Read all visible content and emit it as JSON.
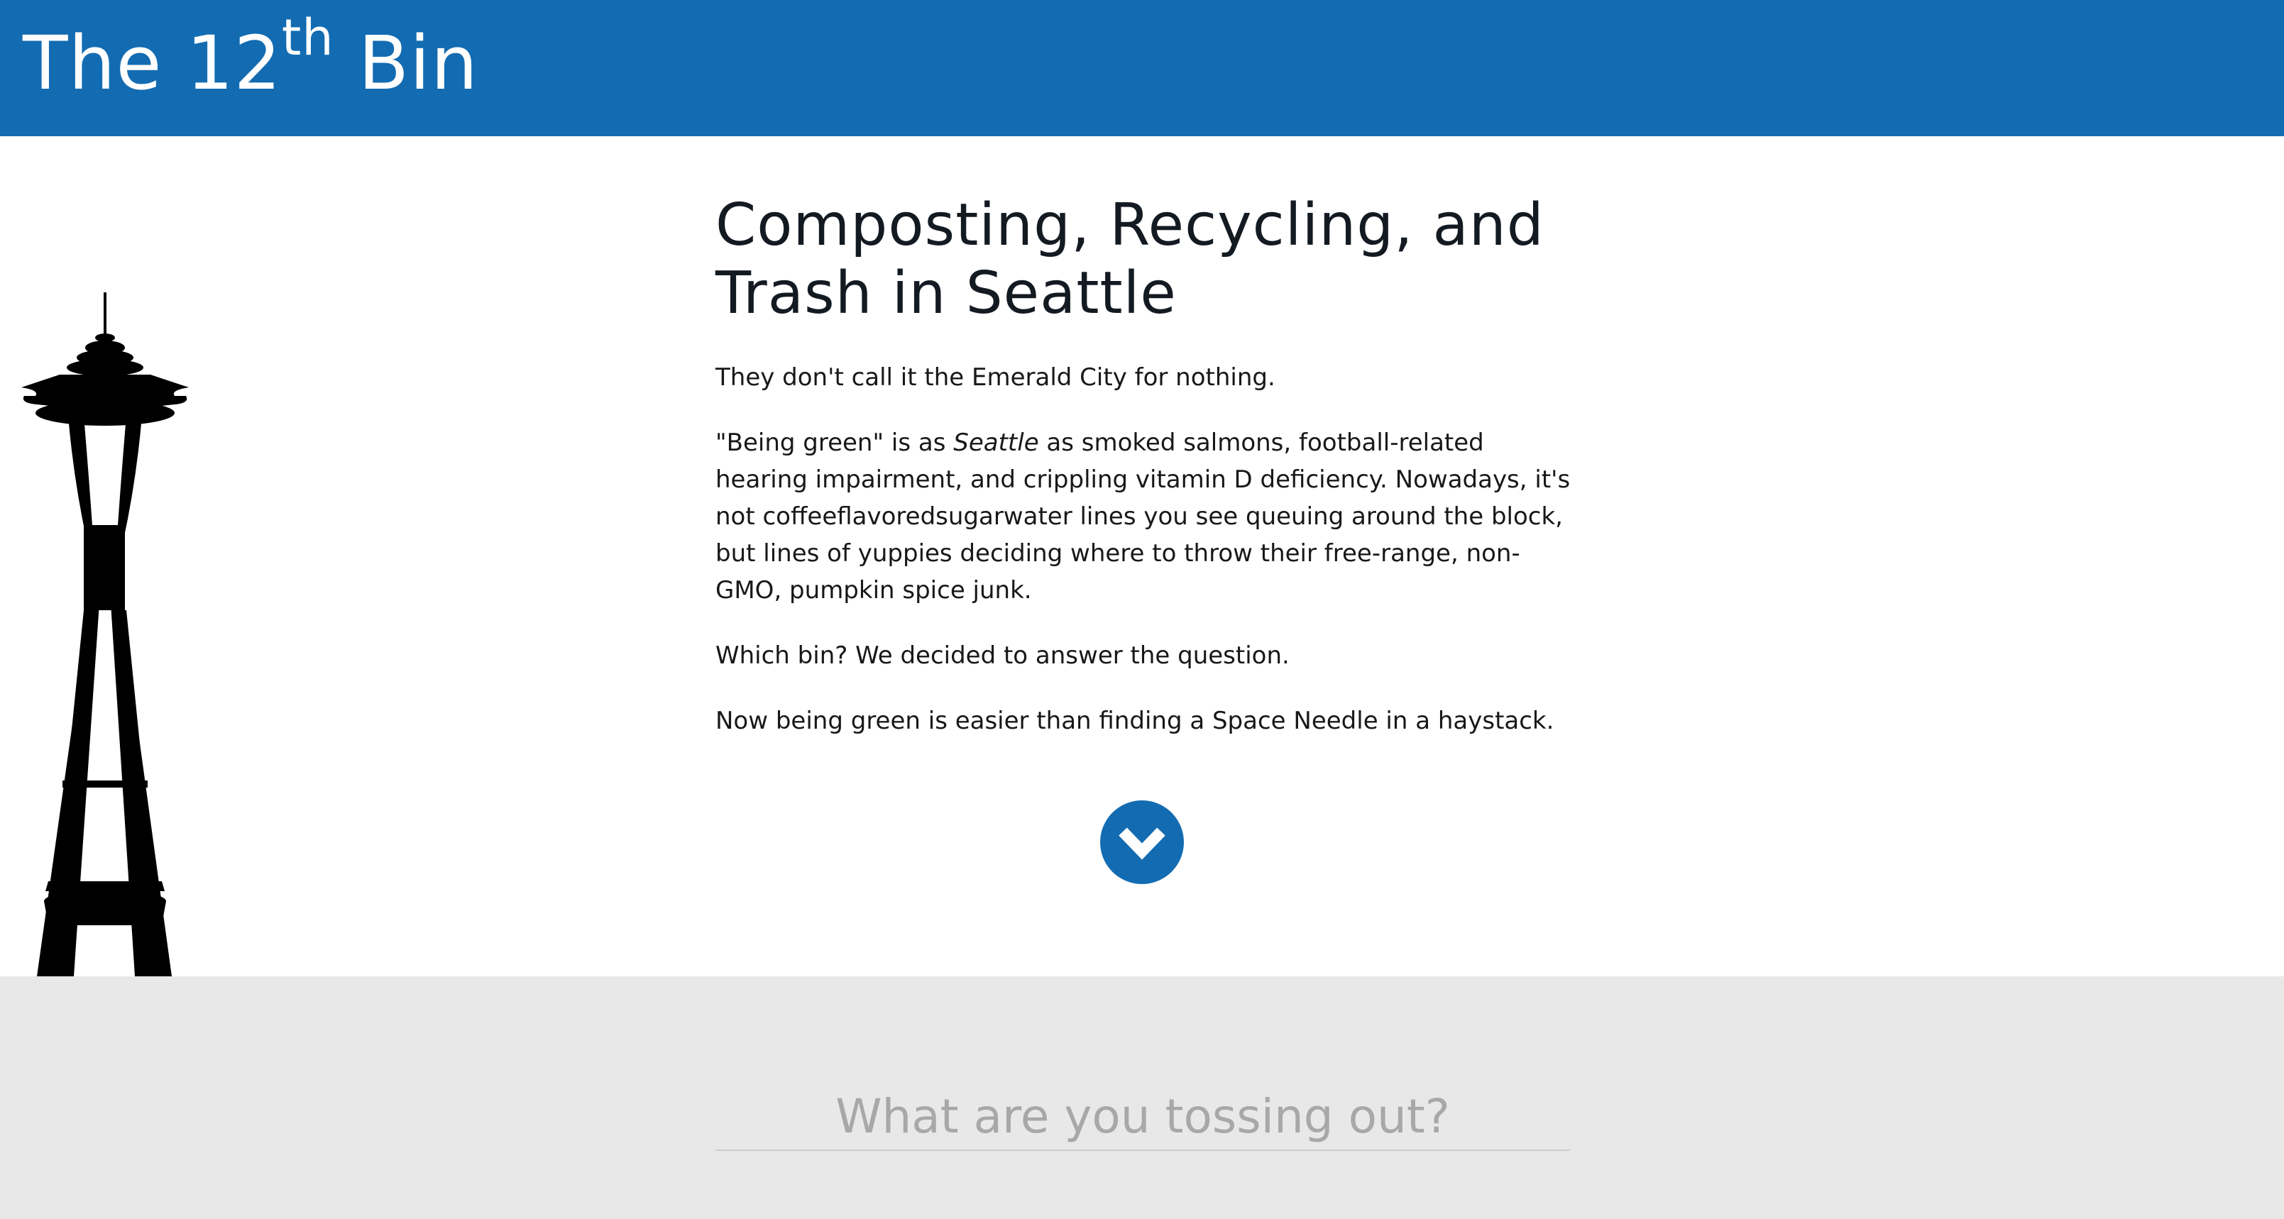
{
  "header": {
    "brand_prefix": "The 12",
    "brand_sup": "th",
    "brand_suffix": " Bin",
    "color": "#136cb2"
  },
  "illustration": {
    "icon": "space-needle-silhouette"
  },
  "main": {
    "title": "Composting, Recycling, and Trash in Seattle",
    "p1": "They don't call it the Emerald City for nothing.",
    "p2_before": "\"Being green\" is as ",
    "p2_em": "Seattle",
    "p2_after": " as smoked salmons, football-related hearing impairment, and crippling vitamin D deficiency. Nowadays, it's not coffeeflavoredsugarwater lines you see queuing around the block, but lines of yuppies deciding where to throw their free-range, non-GMO, pumpkin spice junk.",
    "p3": "Which bin? We decided to answer the question.",
    "p4": "Now being green is easier than finding a Space Needle in a haystack."
  },
  "scroll_button": {
    "icon": "chevron-down-icon"
  },
  "search": {
    "placeholder": "What are you tossing out?",
    "value": ""
  }
}
